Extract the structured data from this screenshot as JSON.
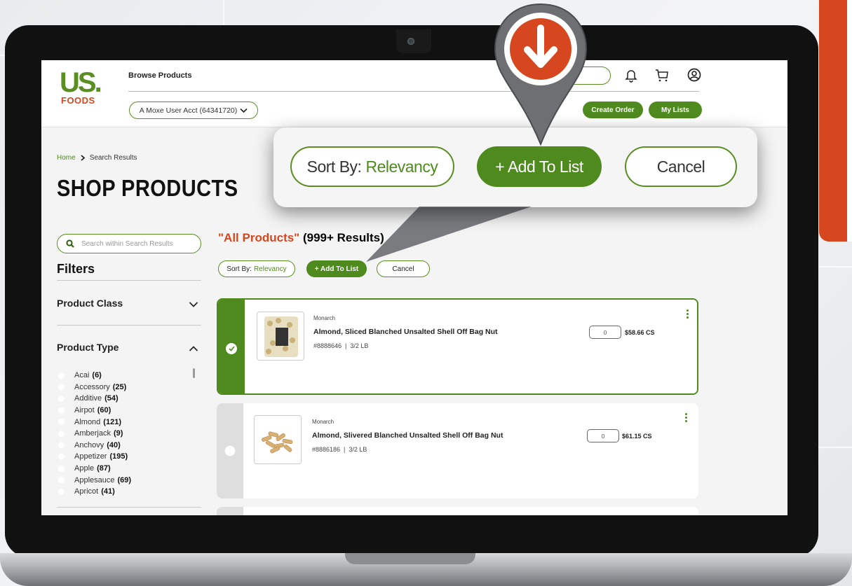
{
  "header": {
    "logo_us": "US.",
    "logo_foods": "FOODS",
    "browse_label": "Browse Products",
    "account_select": "A Moxe User Acct (64341720)",
    "create_order": "Create Order",
    "my_lists": "My Lists"
  },
  "breadcrumb": {
    "home": "Home",
    "current": "Search Results"
  },
  "page_title": "SHOP PRODUCTS",
  "sidebar": {
    "search_placeholder": "Search within Search Results",
    "filters_title": "Filters",
    "product_class": "Product Class",
    "product_type": "Product Type",
    "types": [
      {
        "label": "Acai",
        "count": "(6)"
      },
      {
        "label": "Accessory",
        "count": "(25)"
      },
      {
        "label": "Additive",
        "count": "(54)"
      },
      {
        "label": "Airpot",
        "count": "(60)"
      },
      {
        "label": "Almond",
        "count": "(121)"
      },
      {
        "label": "Amberjack",
        "count": "(9)"
      },
      {
        "label": "Anchovy",
        "count": "(40)"
      },
      {
        "label": "Appetizer",
        "count": "(195)"
      },
      {
        "label": "Apple",
        "count": "(87)"
      },
      {
        "label": "Applesauce",
        "count": "(69)"
      },
      {
        "label": "Apricot",
        "count": "(41)"
      }
    ]
  },
  "results": {
    "query": "\"All Products\"",
    "count": "(999+ Results)",
    "sort_label": "Sort By:",
    "sort_value": "Relevancy",
    "add_to_list": "+ Add To List",
    "cancel": "Cancel"
  },
  "products": [
    {
      "brand": "Monarch",
      "name": "Almond, Sliced Blanched Unsalted Shell Off Bag Nut",
      "sku": "#8888646",
      "pack": "3/2 LB",
      "qty": "0",
      "price": "$58.66 CS",
      "selected": true
    },
    {
      "brand": "Monarch",
      "name": "Almond, Slivered Blanched Unsalted Shell Off Bag Nut",
      "sku": "#8886186",
      "pack": "3/2 LB",
      "qty": "0",
      "price": "$61.15 CS",
      "selected": false
    }
  ],
  "callout": {
    "sort_label": "Sort By:",
    "sort_value": "Relevancy",
    "add_to_list": "+ Add To List",
    "cancel": "Cancel"
  },
  "colors": {
    "brand_green": "#4f8a1f",
    "brand_orange": "#d6461f"
  },
  "icons": [
    "bell-icon",
    "cart-icon",
    "user-icon",
    "search-icon",
    "download-arrow-icon"
  ]
}
